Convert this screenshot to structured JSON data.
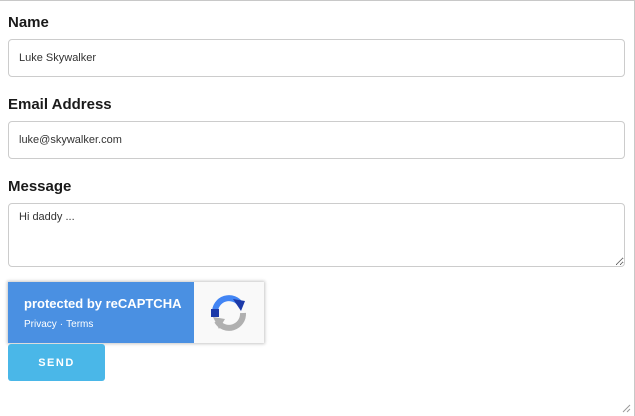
{
  "form": {
    "name": {
      "label": "Name",
      "value": "Luke Skywalker"
    },
    "email": {
      "label": "Email Address",
      "value": "luke@skywalker.com"
    },
    "message": {
      "label": "Message",
      "value": "Hi daddy ..."
    },
    "recaptcha": {
      "title": "protected by reCAPTCHA",
      "privacy_label": "Privacy",
      "separator": "·",
      "terms_label": "Terms",
      "icon": "recaptcha-logo-icon",
      "brand_color": "#4a90e2"
    },
    "send_label": "SEND",
    "send_color": "#4ab7e8"
  }
}
